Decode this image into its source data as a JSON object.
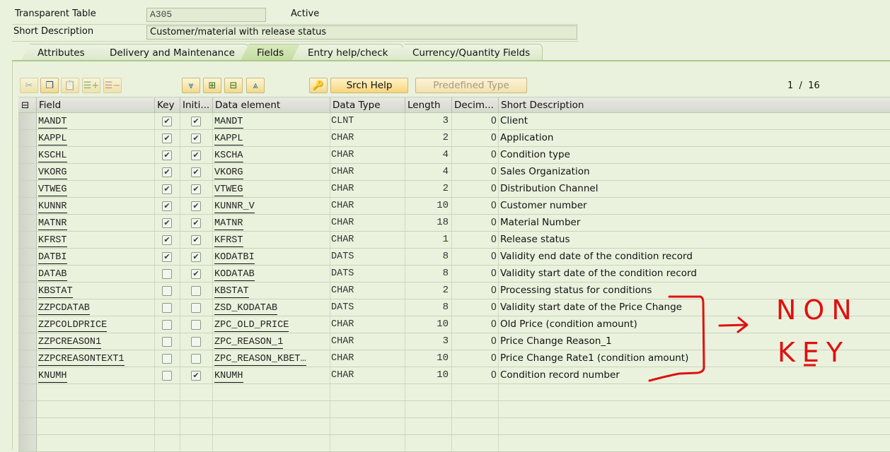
{
  "header": {
    "table_label": "Transparent Table",
    "table_name": "A305",
    "status": "Active",
    "short_desc_label": "Short Description",
    "short_desc_value": "Customer/material with release status"
  },
  "tabs": [
    {
      "label": "Attributes",
      "active": false
    },
    {
      "label": "Delivery and Maintenance",
      "active": false
    },
    {
      "label": "Fields",
      "active": true
    },
    {
      "label": "Entry help/check",
      "active": false
    },
    {
      "label": "Currency/Quantity Fields",
      "active": false
    }
  ],
  "toolbar": {
    "icons": [
      "cut-icon",
      "copy-icon",
      "paste-icon",
      "insert-row-icon",
      "delete-row-icon",
      "expand-all-icon",
      "insert-include-icon",
      "remove-include-icon",
      "collapse-icon",
      "key-search-help-icon"
    ],
    "srch_help_label": "Srch Help",
    "predefined_type_label": "Predefined Type",
    "pager": {
      "current": "1",
      "separator": "/",
      "total": "16"
    }
  },
  "table": {
    "columns": [
      "Field",
      "Key",
      "Initi...",
      "Data element",
      "Data Type",
      "Length",
      "Decim...",
      "Short Description"
    ],
    "rows": [
      {
        "field": "MANDT",
        "key": true,
        "init": true,
        "data_element": "MANDT",
        "data_type": "CLNT",
        "length": "3",
        "decimals": "0",
        "description": "Client"
      },
      {
        "field": "KAPPL",
        "key": true,
        "init": true,
        "data_element": "KAPPL",
        "data_type": "CHAR",
        "length": "2",
        "decimals": "0",
        "description": "Application"
      },
      {
        "field": "KSCHL",
        "key": true,
        "init": true,
        "data_element": "KSCHA",
        "data_type": "CHAR",
        "length": "4",
        "decimals": "0",
        "description": "Condition type"
      },
      {
        "field": "VKORG",
        "key": true,
        "init": true,
        "data_element": "VKORG",
        "data_type": "CHAR",
        "length": "4",
        "decimals": "0",
        "description": "Sales Organization"
      },
      {
        "field": "VTWEG",
        "key": true,
        "init": true,
        "data_element": "VTWEG",
        "data_type": "CHAR",
        "length": "2",
        "decimals": "0",
        "description": "Distribution Channel"
      },
      {
        "field": "KUNNR",
        "key": true,
        "init": true,
        "data_element": "KUNNR_V",
        "data_type": "CHAR",
        "length": "10",
        "decimals": "0",
        "description": "Customer number"
      },
      {
        "field": "MATNR",
        "key": true,
        "init": true,
        "data_element": "MATNR",
        "data_type": "CHAR",
        "length": "18",
        "decimals": "0",
        "description": "Material Number"
      },
      {
        "field": "KFRST",
        "key": true,
        "init": true,
        "data_element": "KFRST",
        "data_type": "CHAR",
        "length": "1",
        "decimals": "0",
        "description": "Release status"
      },
      {
        "field": "DATBI",
        "key": true,
        "init": true,
        "data_element": "KODATBI",
        "data_type": "DATS",
        "length": "8",
        "decimals": "0",
        "description": "Validity end date of the condition record"
      },
      {
        "field": "DATAB",
        "key": false,
        "init": true,
        "data_element": "KODATAB",
        "data_type": "DATS",
        "length": "8",
        "decimals": "0",
        "description": "Validity start date of the condition record"
      },
      {
        "field": "KBSTAT",
        "key": false,
        "init": false,
        "data_element": "KBSTAT",
        "data_type": "CHAR",
        "length": "2",
        "decimals": "0",
        "description": "Processing status for conditions"
      },
      {
        "field": "ZZPCDATAB",
        "key": false,
        "init": false,
        "data_element": "ZSD_KODATAB",
        "data_type": "DATS",
        "length": "8",
        "decimals": "0",
        "description": "Validity start date of the Price Change"
      },
      {
        "field": "ZZPCOLDPRICE",
        "key": false,
        "init": false,
        "data_element": "ZPC_OLD_PRICE",
        "data_type": "CHAR",
        "length": "10",
        "decimals": "0",
        "description": "Old Price (condition amount)"
      },
      {
        "field": "ZZPCREASON1",
        "key": false,
        "init": false,
        "data_element": "ZPC_REASON_1",
        "data_type": "CHAR",
        "length": "3",
        "decimals": "0",
        "description": "Price Change Reason_1"
      },
      {
        "field": "ZZPCREASONTEXT1",
        "key": false,
        "init": false,
        "data_element": "ZPC_REASON_KBET…",
        "data_type": "CHAR",
        "length": "10",
        "decimals": "0",
        "description": "Price Change Rate1 (condition amount)"
      },
      {
        "field": "KNUMH",
        "key": false,
        "init": true,
        "data_element": "KNUMH",
        "data_type": "CHAR",
        "length": "10",
        "decimals": "0",
        "description": "Condition record number"
      }
    ],
    "empty_rows": 4
  },
  "annotation": {
    "text_line1": "NON",
    "text_line2": "KEY",
    "color": "#e01010"
  },
  "colors": {
    "background": "#eaf2dd",
    "active_tab": "#c3dca0",
    "button": "#f8d57a"
  }
}
